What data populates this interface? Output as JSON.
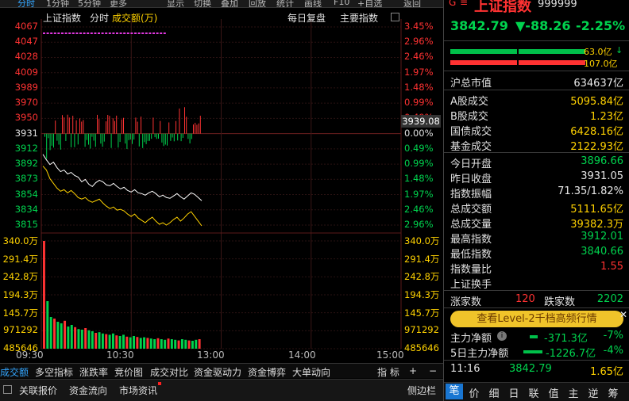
{
  "topbar": {
    "tabs": [
      "分时",
      "1分钟",
      "5分钟",
      "更多",
      "显示",
      "切换",
      "叠加",
      "回放",
      "统计",
      "画线",
      "F10",
      "+自选",
      "返回"
    ]
  },
  "chart_header": {
    "index_name": "上证指数",
    "mode": "分时",
    "metric": "成交额(万)",
    "daily_replay": "每日复盘",
    "main_index": "主要指数"
  },
  "price_axis": {
    "left": [
      "4067",
      "4047",
      "4028",
      "4009",
      "3989",
      "3970",
      "3950",
      "3931",
      "3912",
      "3892",
      "3873",
      "3854",
      "3834",
      "3815"
    ],
    "right": [
      "3.45%",
      "2.96%",
      "2.46%",
      "1.97%",
      "1.48%",
      "0.99%",
      "0.49%",
      "0.00%",
      "0.49%",
      "0.99%",
      "1.48%",
      "1.97%",
      "2.46%",
      "2.96%"
    ],
    "current_label": "3939.08"
  },
  "volume_axis": {
    "left": [
      "340.0万",
      "291.4万",
      "242.8万",
      "194.3万",
      "145.7万",
      "971292",
      "485646"
    ],
    "right": [
      "340.0万",
      "291.4万",
      "242.8万",
      "194.3万",
      "145.7万",
      "971292",
      "485646"
    ]
  },
  "time_axis": [
    "09:30",
    "10:30",
    "13:00",
    "14:00",
    "15:00"
  ],
  "chart_data": {
    "type": "line",
    "ylim": [
      3815,
      4067
    ],
    "prev_close": 3931.05,
    "price": [
      3905,
      3898,
      3892,
      3895,
      3888,
      3883,
      3885,
      3880,
      3882,
      3878,
      3876,
      3870,
      3873,
      3867,
      3864,
      3869,
      3872,
      3870,
      3866,
      3865,
      3868,
      3864,
      3861,
      3863,
      3859,
      3857,
      3860,
      3856,
      3855,
      3853,
      3856,
      3858,
      3855,
      3851,
      3853,
      3850,
      3849,
      3852,
      3855,
      3851,
      3848,
      3852,
      3856,
      3854,
      3850,
      3846
    ],
    "avg": [
      3890,
      3885,
      3874,
      3868,
      3862,
      3858,
      3860,
      3856,
      3859,
      3855,
      3850,
      3848,
      3850,
      3846,
      3844,
      3846,
      3848,
      3843,
      3839,
      3836,
      3838,
      3834,
      3835,
      3833,
      3829,
      3826,
      3829,
      3824,
      3821,
      3818,
      3822,
      3825,
      3820,
      3816,
      3818,
      3815,
      3818,
      3822,
      3825,
      3820,
      3824,
      3829,
      3832,
      3826,
      3820,
      3814
    ],
    "volume": [
      340,
      150,
      100,
      95,
      85,
      80,
      88,
      70,
      75,
      68,
      62,
      60,
      65,
      58,
      55,
      50,
      52,
      48,
      46,
      44,
      48,
      42,
      40,
      44,
      38,
      36,
      40,
      37,
      34,
      36,
      34,
      32,
      30,
      33,
      30,
      28,
      32,
      30,
      28,
      26,
      30,
      28,
      26,
      25,
      28,
      30
    ]
  },
  "right_panel": {
    "title": "上证指数",
    "code": "999999",
    "price": "3842.79",
    "change": "▼-88.26",
    "change_pct": "-2.25%",
    "bar_up_value": "63.0亿",
    "bar_down_value": "107.0亿",
    "market_cap_label": "沪总市值",
    "market_cap": "634637亿",
    "a_share_label": "A股成交",
    "a_share": "5095.84亿",
    "b_share_label": "B股成交",
    "b_share": "1.23亿",
    "bond_label": "国债成交",
    "bond": "6428.16亿",
    "fund_label": "基金成交",
    "fund": "2122.93亿",
    "open_label": "今日开盘",
    "open": "3896.66",
    "prev_close_label": "昨日收盘",
    "prev_close": "3931.05",
    "amplitude_label": "指数振幅",
    "amplitude": "71.35/1.82%",
    "total_amount_label": "总成交额",
    "total_amount": "5111.65亿",
    "total_volume_label": "总成交量",
    "total_volume": "39382.3万",
    "high_label": "最高指数",
    "high": "3912.01",
    "low_label": "最低指数",
    "low": "3840.66",
    "vol_ratio_label": "指数量比",
    "vol_ratio": "1.55",
    "turnover_label": "上证换手",
    "up_count_label": "涨家数",
    "up_count": "120",
    "down_count_label": "跌家数",
    "down_count": "2202",
    "level2_banner": "查看Level-2千档高频行情",
    "main_net_label": "主力净额",
    "main_net": "-371.3亿",
    "main_net_pct": "-7%",
    "main_net5_label": "5日主力净额",
    "main_net5": "-1226.7亿",
    "main_net5_pct": "-4%",
    "tick_time": "11:16",
    "tick_price": "3842.79",
    "tick_amount": "1.65亿",
    "tabs": [
      "笔",
      "价",
      "细",
      "日",
      "联",
      "值",
      "主",
      "逆",
      "筹"
    ]
  },
  "indicator_tabs": {
    "items": [
      "成交额",
      "多空指标",
      "涨跌率",
      "竞价图",
      "成交对比",
      "资金驱动力",
      "资金博弈",
      "大单动向"
    ],
    "right": [
      "指 标",
      "+",
      "−"
    ]
  },
  "bottom_bar": {
    "items": [
      "关联报价",
      "资金流向",
      "市场资讯"
    ],
    "sidebar": "侧边栏"
  },
  "colors": {
    "up": "#ff3232",
    "down": "#00d34e",
    "price_line": "#ffffff",
    "avg_line": "#ffd200",
    "highlight": "#33a6ff"
  }
}
